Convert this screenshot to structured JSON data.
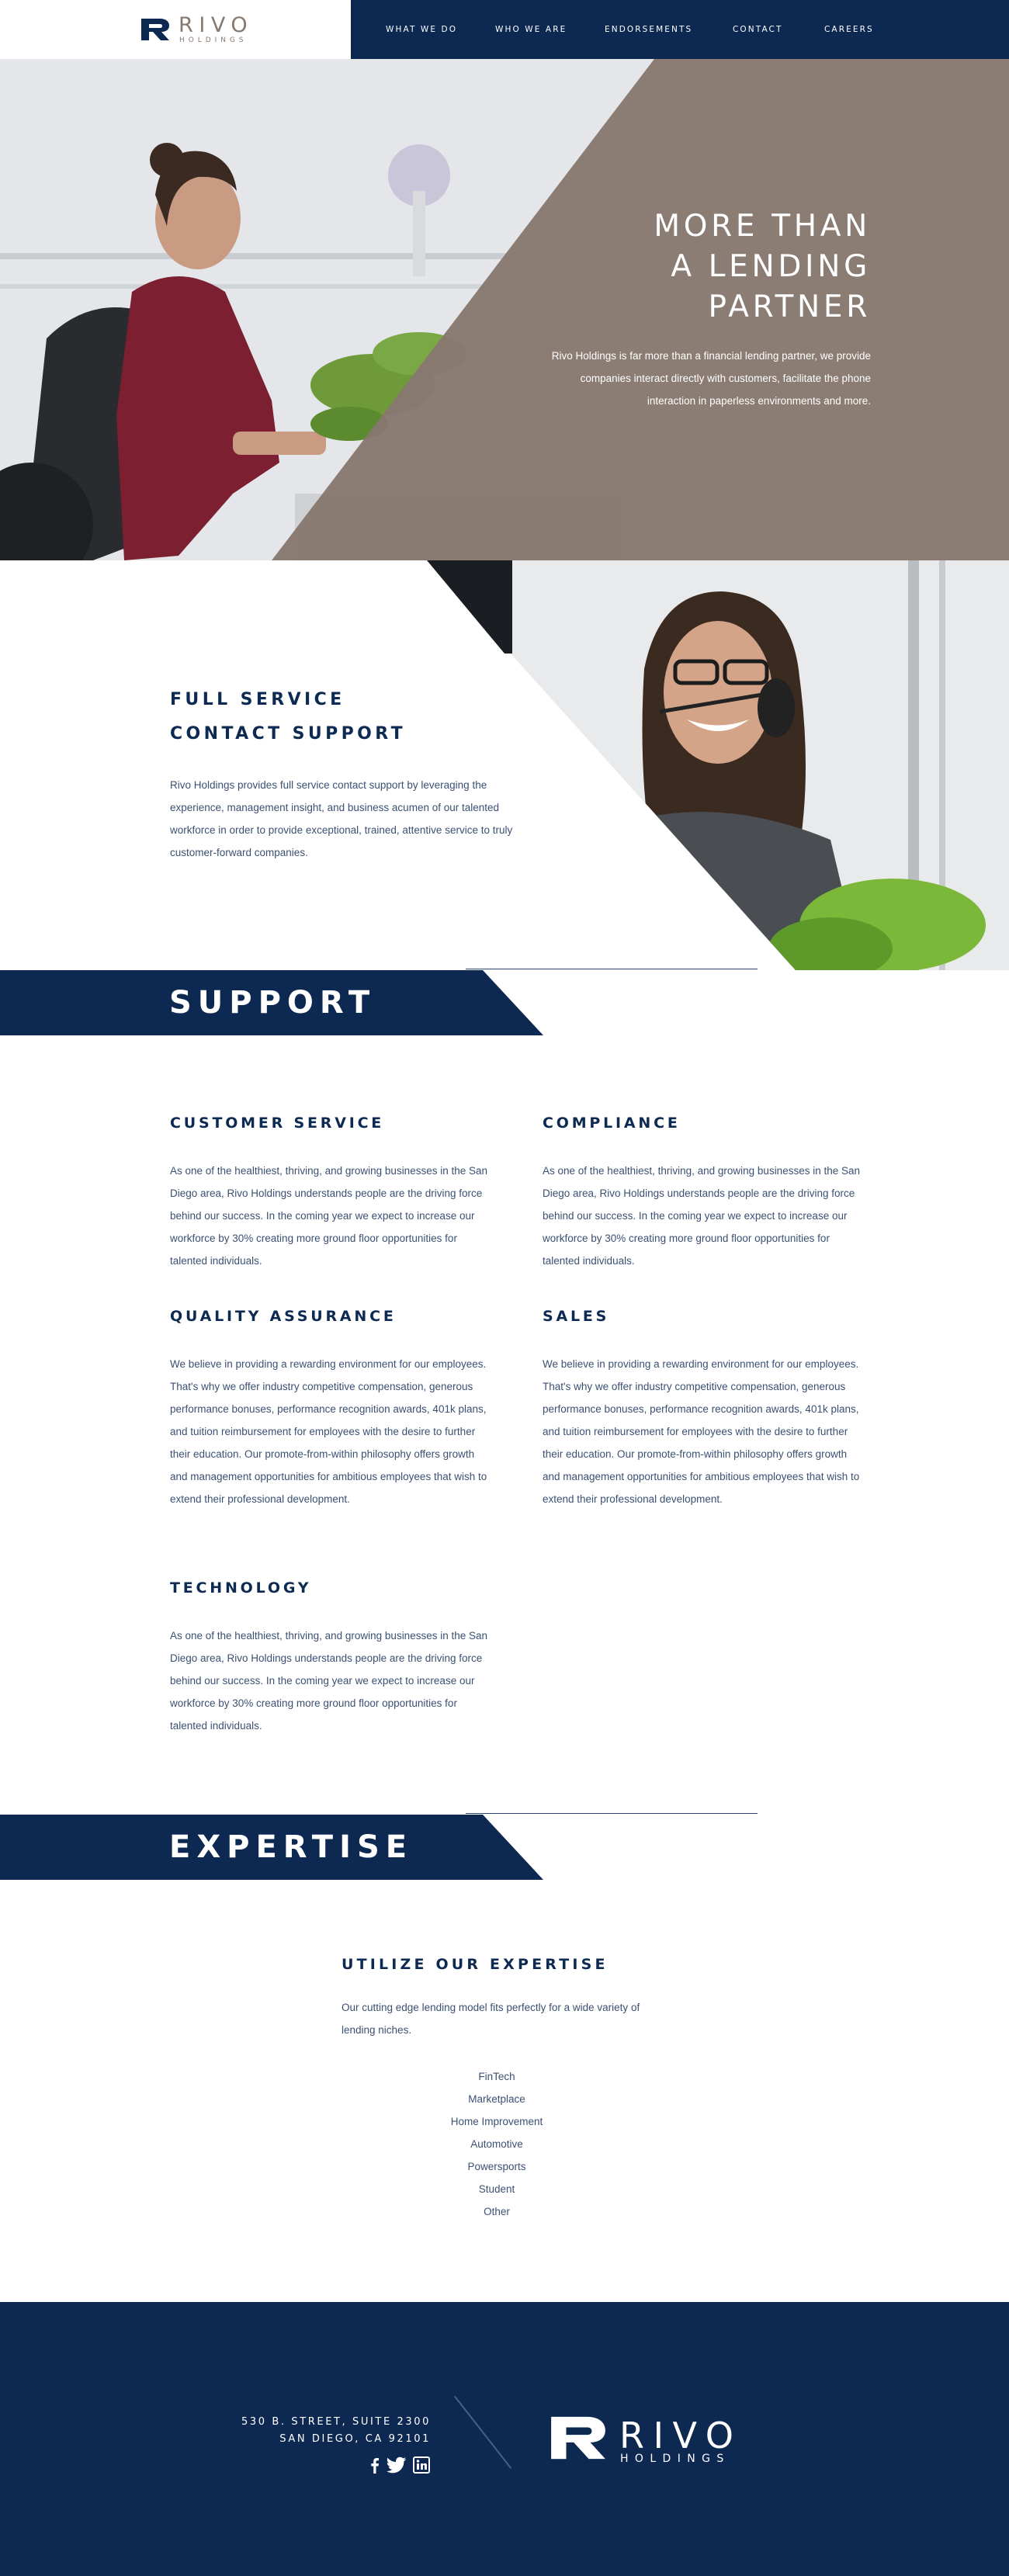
{
  "brand": {
    "name": "RIVO",
    "tagline": "HOLDINGS",
    "colors": {
      "navy": "#0d2851",
      "taupe": "#877870",
      "text": "#3b5072"
    }
  },
  "nav": {
    "items": [
      {
        "label": "WHAT WE DO"
      },
      {
        "label": "WHO WE ARE"
      },
      {
        "label": "ENDORSEMENTS"
      },
      {
        "label": "CONTACT"
      },
      {
        "label": "CAREERS"
      }
    ]
  },
  "hero": {
    "title_line1": "MORE THAN",
    "title_line2": "A LENDING",
    "title_line3": "PARTNER",
    "text": "Rivo Holdings is far more than a financial lending partner, we provide companies interact directly with customers, facilitate the phone interaction in paperless environments and more."
  },
  "contact": {
    "title_line1": "FULL SERVICE",
    "title_line2": "CONTACT SUPPORT",
    "text": "Rivo Holdings provides full service contact support by leveraging the experience, management insight, and business acumen of our talented workforce in order to provide exceptional, trained, attentive service to truly customer-forward companies."
  },
  "support": {
    "band_title": "SUPPORT",
    "services": [
      {
        "title": "CUSTOMER SERVICE",
        "text": "As one of the healthiest, thriving, and growing businesses in the San Diego area, Rivo Holdings understands people are the driving force behind our success. In the coming year we expect to increase our workforce by 30% creating more ground floor opportunities for talented individuals."
      },
      {
        "title": "COMPLIANCE",
        "text": "As one of the healthiest, thriving, and growing businesses in the San Diego area, Rivo Holdings understands people are the driving force behind our success. In the coming year we expect to increase our workforce by 30% creating more ground floor opportunities for talented individuals."
      },
      {
        "title": "QUALITY ASSURANCE",
        "text": "We believe in providing a rewarding environment for our employees.  That's why we offer industry competitive compensation, generous performance bonuses, performance recognition awards, 401k plans, and tuition reimbursement for employees with the desire to further their education.  Our promote-from-within philosophy offers growth and management opportunities for ambitious employees that wish to extend their professional development."
      },
      {
        "title": "SALES",
        "text": "We believe in providing a rewarding environment for our employees.  That's why we offer industry competitive compensation, generous performance bonuses, performance recognition awards, 401k plans, and tuition reimbursement for employees with the desire to further their education.  Our promote-from-within philosophy offers growth and management opportunities for ambitious employees that wish to extend their professional development."
      },
      {
        "title": "TECHNOLOGY",
        "text": "As one of the healthiest, thriving, and growing businesses in the San Diego area, Rivo Holdings understands people are the driving force behind our success. In the coming year we expect to increase our workforce by 30% creating more ground floor opportunities for talented individuals."
      }
    ]
  },
  "expertise": {
    "band_title": "EXPERTISE",
    "title": "UTILIZE OUR EXPERTISE",
    "text": "Our cutting edge lending model fits perfectly for a wide variety of lending niches.",
    "niches": [
      "FinTech",
      "Marketplace",
      "Home Improvement",
      "Automotive",
      "Powersports",
      "Student",
      "Other"
    ]
  },
  "footer": {
    "address_line1": "530 B. STREET, SUITE 2300",
    "address_line2": "SAN DIEGO, CA 92101",
    "social": [
      "facebook-icon",
      "twitter-icon",
      "linkedin-icon"
    ]
  }
}
